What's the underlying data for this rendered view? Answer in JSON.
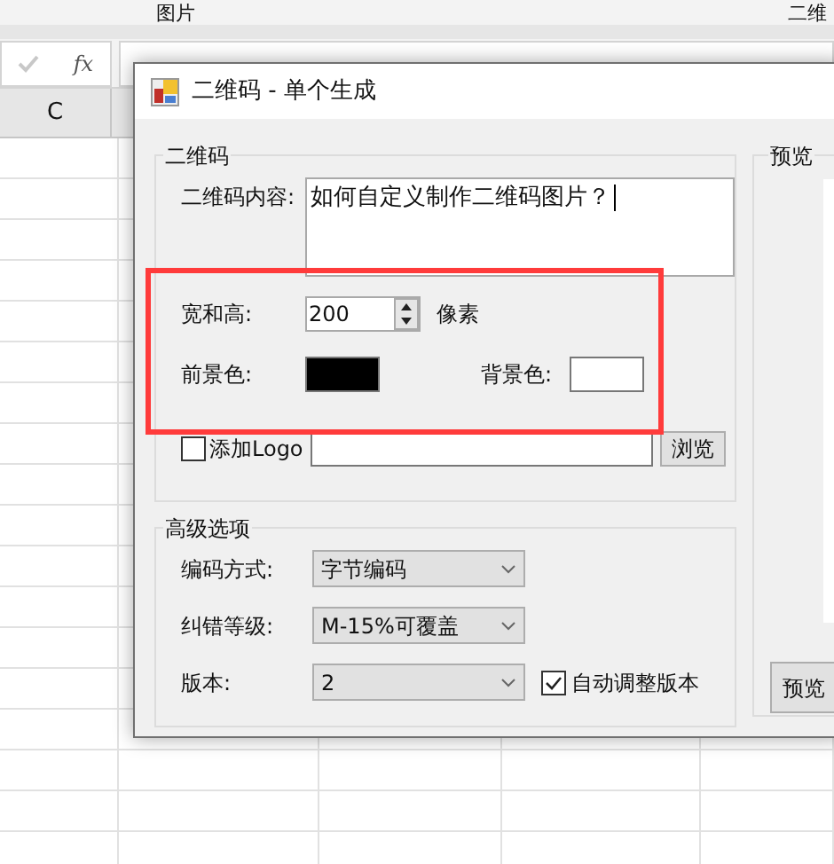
{
  "spreadsheet": {
    "ribbon_labels": [
      "图片",
      "二维"
    ],
    "formula_function": "fx",
    "column_header": "C"
  },
  "dialog": {
    "title": "二维码 - 单个生成",
    "qr_group": {
      "title": "二维码",
      "content_label": "二维码内容:",
      "content_value": "如何自定义制作二维码图片？",
      "size_label": "宽和高:",
      "size_value": "200",
      "size_unit": "像素",
      "foreground": {
        "label": "前景色:",
        "color": "#000000"
      },
      "background": {
        "label": "背景色:",
        "color": "#ffffff"
      },
      "logo": {
        "label": "添加Logo",
        "checked": false
      },
      "browse": "浏览"
    },
    "advanced": {
      "title": "高级选项",
      "fields": [
        {
          "label": "编码方式:",
          "value": "字节编码"
        },
        {
          "label": "纠错等级:",
          "value": "M-15%可覆盖"
        },
        {
          "label": "版本:",
          "value": "2"
        }
      ],
      "auto_version": {
        "label": "自动调整版本",
        "checked": true
      }
    },
    "preview": {
      "title": "预览",
      "button": "预览"
    }
  }
}
